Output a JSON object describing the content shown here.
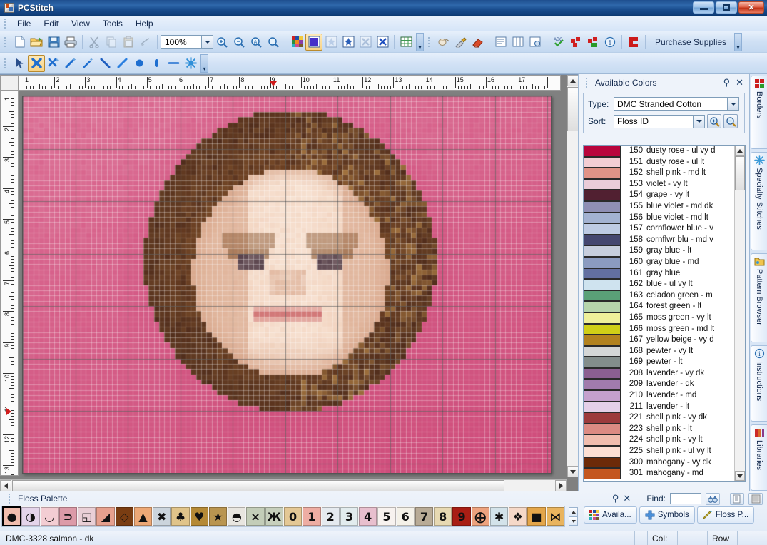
{
  "window": {
    "title": "PCStitch",
    "icon": "app-icon",
    "buttons": {
      "minimize": "minimize",
      "maximize": "maximize",
      "close": "close"
    }
  },
  "menu": {
    "items": [
      "File",
      "Edit",
      "View",
      "Tools",
      "Help"
    ]
  },
  "toolbar_main": {
    "zoom_value": "100%",
    "purchase_label": "Purchase Supplies",
    "overflow": "toolbar-overflow",
    "icons": [
      "new-document-icon",
      "open-folder-icon",
      "save-disk-icon",
      "print-icon",
      "cut-scissors-icon",
      "copy-icon",
      "paste-icon",
      "format-painter-icon",
      "zoom-in-icon",
      "zoom-out-icon",
      "zoom-actual-icon",
      "zoom-fit-icon",
      "palette-colors-icon",
      "full-stitch-icon",
      "three-quarter-stitch-icon",
      "half-stitch-icon",
      "quarter-stitch-icon",
      "backstitch-icon",
      "grid-icon",
      "knot-icon",
      "eyedropper-icon",
      "eraser-icon",
      "list-view-icon",
      "columns-view-icon",
      "page-view-icon",
      "spellcheck-icon",
      "pattern-red-icon",
      "pattern-green-icon",
      "info-icon",
      "supplies-icon"
    ]
  },
  "toolbar_tools": {
    "selected": "cross-stitch-tool",
    "icons": [
      "arrow-select-tool",
      "cross-stitch-tool",
      "magic-stitch-tool",
      "wand-fill-tool",
      "sparkle-tool",
      "backslash-line-tool",
      "slash-line-tool",
      "dot-knot-tool",
      "bead-tool",
      "straight-line-tool",
      "starburst-tool"
    ],
    "overflow": "toolbar-overflow"
  },
  "ruler": {
    "h_labels": [
      "1",
      "2",
      "3",
      "4",
      "5",
      "6",
      "7",
      "8",
      "9",
      "10",
      "11",
      "12",
      "13",
      "14",
      "15",
      "16",
      "17"
    ],
    "v_labels": [
      "1",
      "2",
      "3",
      "4",
      "5",
      "6",
      "7",
      "8",
      "9",
      "10",
      "11",
      "12",
      "13"
    ],
    "h_marker_at": "9",
    "v_marker_at": "11"
  },
  "colors_panel": {
    "title": "Available Colors",
    "pin": "pin-icon",
    "close": "close-icon",
    "type_label": "Type:",
    "type_value": "DMC Stranded Cotton",
    "sort_label": "Sort:",
    "sort_value": "Floss ID",
    "zoom_in": "magnifier-plus-icon",
    "zoom_out": "magnifier-minus-icon",
    "colors": [
      {
        "id": "150",
        "name": "dusty rose - ul vy d",
        "hex": "#b8053c"
      },
      {
        "id": "151",
        "name": "dusty rose - ul lt",
        "hex": "#f3cdd3"
      },
      {
        "id": "152",
        "name": "shell pink - md lt",
        "hex": "#e09387"
      },
      {
        "id": "153",
        "name": "violet - vy lt",
        "hex": "#e9ccd8"
      },
      {
        "id": "154",
        "name": "grape - vy lt",
        "hex": "#512031"
      },
      {
        "id": "155",
        "name": "blue violet - md dk",
        "hex": "#8f8fb4"
      },
      {
        "id": "156",
        "name": "blue violet - md lt",
        "hex": "#a3b2d1"
      },
      {
        "id": "157",
        "name": "cornflower blue - v",
        "hex": "#becbe3"
      },
      {
        "id": "158",
        "name": "cornflwr blu - md v",
        "hex": "#45476f"
      },
      {
        "id": "159",
        "name": "gray blue - lt",
        "hex": "#c7cedd"
      },
      {
        "id": "160",
        "name": "gray blue - md",
        "hex": "#8b9bc0"
      },
      {
        "id": "161",
        "name": "gray blue",
        "hex": "#636fa0"
      },
      {
        "id": "162",
        "name": "blue - ul vy lt",
        "hex": "#cfe3ef"
      },
      {
        "id": "163",
        "name": "celadon green - m",
        "hex": "#5aa077"
      },
      {
        "id": "164",
        "name": "forest green - lt",
        "hex": "#b6d4ab"
      },
      {
        "id": "165",
        "name": "moss green - vy lt",
        "hex": "#eff09a"
      },
      {
        "id": "166",
        "name": "moss green - md lt",
        "hex": "#d0cf17"
      },
      {
        "id": "167",
        "name": "yellow beige - vy d",
        "hex": "#b2821f"
      },
      {
        "id": "168",
        "name": "pewter - vy lt",
        "hex": "#d4d6d6"
      },
      {
        "id": "169",
        "name": "pewter - lt",
        "hex": "#838d8b"
      },
      {
        "id": "208",
        "name": "lavender - vy dk",
        "hex": "#8b5f91"
      },
      {
        "id": "209",
        "name": "lavender - dk",
        "hex": "#a17bad"
      },
      {
        "id": "210",
        "name": "lavender - md",
        "hex": "#c5a0cd"
      },
      {
        "id": "211",
        "name": "lavender - lt",
        "hex": "#e4cfe8"
      },
      {
        "id": "221",
        "name": "shell pink - vy dk",
        "hex": "#9c3a3c"
      },
      {
        "id": "223",
        "name": "shell pink - lt",
        "hex": "#dc8b83"
      },
      {
        "id": "224",
        "name": "shell pink - vy lt",
        "hex": "#f0bdae"
      },
      {
        "id": "225",
        "name": "shell pink - ul vy lt",
        "hex": "#fcdfd3"
      },
      {
        "id": "300",
        "name": "mahogany - vy dk",
        "hex": "#6c2a08"
      },
      {
        "id": "301",
        "name": "mahogany - md",
        "hex": "#c4571f"
      }
    ]
  },
  "side_tabs": [
    {
      "label": "Borders",
      "icon": "borders-icon"
    },
    {
      "label": "Specialty Stitches",
      "icon": "snowflake-icon"
    },
    {
      "label": "Pattern Browser",
      "icon": "folder-pattern-icon"
    },
    {
      "label": "Instructions",
      "icon": "info-icon"
    },
    {
      "label": "Libraries",
      "icon": "libraries-icon"
    }
  ],
  "floss_dock": {
    "title": "Floss Palette",
    "pin": "pin-icon",
    "close": "close-icon",
    "find_label": "Find:",
    "find_value": "",
    "find_button": "binoculars-icon",
    "list_button": "list-report-icon",
    "grid_button": "grid-pattern-icon",
    "spinner_up": "spinner-up-icon",
    "spinner_down": "spinner-down-icon",
    "selected_index": 0,
    "symbols": [
      {
        "glyph": "●",
        "bg": "#f0bdae",
        "sel": true
      },
      {
        "glyph": "◑",
        "bg": "#e4d4ea",
        "sel": false
      },
      {
        "glyph": "◡",
        "bg": "#f3cdd3",
        "sel": false
      },
      {
        "glyph": "⊃",
        "bg": "#dc9aa8",
        "sel": false
      },
      {
        "glyph": "◱",
        "bg": "#e9cfd6",
        "sel": false
      },
      {
        "glyph": "◢",
        "bg": "#e6a08e",
        "sel": false
      },
      {
        "glyph": "◇",
        "bg": "#7a3d12",
        "sel": false
      },
      {
        "glyph": "▲",
        "bg": "#eda876",
        "sel": false
      },
      {
        "glyph": "✖",
        "bg": "#cbd4dc",
        "sel": false
      },
      {
        "glyph": "♣",
        "bg": "#e0c48a",
        "sel": false
      },
      {
        "glyph": "♥",
        "bg": "#b58a36",
        "sel": false
      },
      {
        "glyph": "★",
        "bg": "#b99550",
        "sel": false
      },
      {
        "glyph": "◓",
        "bg": "#e8e6e0",
        "sel": false
      },
      {
        "glyph": "⨯",
        "bg": "#c3cdb8",
        "sel": false
      },
      {
        "glyph": "Ж",
        "bg": "#c6cfbc",
        "sel": false
      },
      {
        "glyph": "0",
        "bg": "#e4c895",
        "sel": false
      },
      {
        "glyph": "1",
        "bg": "#eeada3",
        "sel": false
      },
      {
        "glyph": "2",
        "bg": "#e5eaef",
        "sel": false
      },
      {
        "glyph": "3",
        "bg": "#e2ecee",
        "sel": false
      },
      {
        "glyph": "4",
        "bg": "#e8bfce",
        "sel": false
      },
      {
        "glyph": "5",
        "bg": "#f7f2ef",
        "sel": false
      },
      {
        "glyph": "6",
        "bg": "#f4f1e8",
        "sel": false
      },
      {
        "glyph": "7",
        "bg": "#b8ab96",
        "sel": false
      },
      {
        "glyph": "8",
        "bg": "#e7d9b2",
        "sel": false
      },
      {
        "glyph": "9",
        "bg": "#a81e14",
        "sel": false
      },
      {
        "glyph": "⨁",
        "bg": "#eda27e",
        "sel": false
      },
      {
        "glyph": "✱",
        "bg": "#d3e3ea",
        "sel": false
      },
      {
        "glyph": "❖",
        "bg": "#f5d8c8",
        "sel": false
      },
      {
        "glyph": "■",
        "bg": "#e4a64a",
        "sel": false
      },
      {
        "glyph": "⋈",
        "bg": "#e9b45e",
        "sel": false
      }
    ],
    "tabs": [
      {
        "label": "Availa...",
        "icon": "palette-colors-icon"
      },
      {
        "label": "Symbols",
        "icon": "plus-blue-icon"
      },
      {
        "label": "Floss P...",
        "icon": "pencil-icon"
      }
    ]
  },
  "statusbar": {
    "message": "DMC-3328  salmon - dk",
    "col_label": "Col:",
    "col_value": "",
    "row_label": "Row",
    "row_value": ""
  },
  "canvas": {
    "description": "cross-stitch-pattern-portrait",
    "background_hex": "#d8547f",
    "zoom": "100%"
  }
}
